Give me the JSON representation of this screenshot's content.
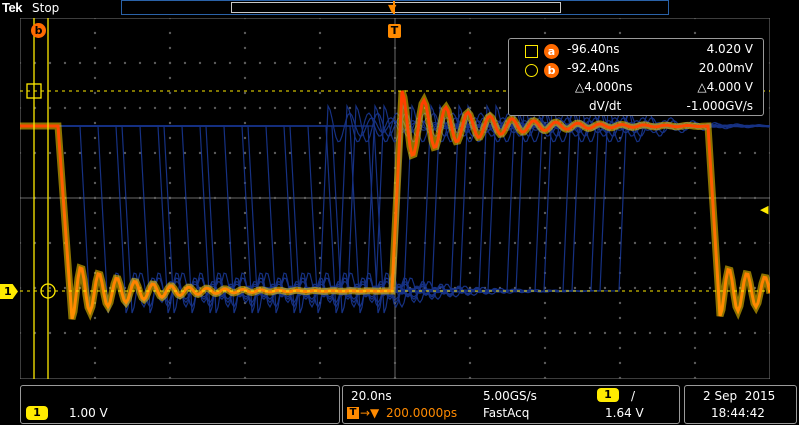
{
  "header": {
    "brand": "Tek",
    "run_state": "Stop"
  },
  "markers": {
    "cursor_b_badge": "b",
    "trigger_position": "T",
    "ch1_ground": "1"
  },
  "cursor_readout": {
    "cursor_a": {
      "badge": "a",
      "time": "-96.40ns",
      "value": "4.020 V"
    },
    "cursor_b": {
      "badge": "b",
      "time": "-92.40ns",
      "value": "20.00mV"
    },
    "delta": {
      "time": "△4.000ns",
      "value": "△4.000 V"
    },
    "slope": {
      "label": "dV/dt",
      "value": "-1.000GV/s"
    }
  },
  "channel1": {
    "badge": "1",
    "scale": "1.00 V"
  },
  "horizontal": {
    "time_per_div": "20.0ns",
    "sample_rate": "5.00GS/s",
    "trigger_position": "200.0000ps",
    "acq_mode": "FastAcq",
    "trigger_source": "1",
    "trigger_slope": "/",
    "trigger_level": "1.64 V"
  },
  "datetime": {
    "date": "2 Sep  2015",
    "time": "18:44:42"
  },
  "colors": {
    "ch1": "#ffeb00",
    "cursor": "#ff6a00",
    "trigger": "#ff8a00",
    "graticule": "#8a8a8a"
  }
}
